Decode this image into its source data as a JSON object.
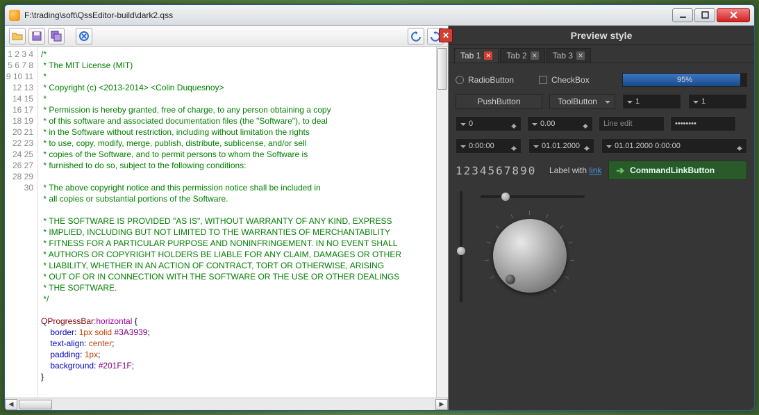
{
  "window": {
    "title": "F:\\trading\\soft\\QssEditor-build\\dark2.qss"
  },
  "editor": {
    "lines": [
      {
        "n": 1,
        "t": "/*",
        "cls": "c"
      },
      {
        "n": 2,
        "t": " * The MIT License (MIT)",
        "cls": "c"
      },
      {
        "n": 3,
        "t": " *",
        "cls": "c"
      },
      {
        "n": 4,
        "t": " * Copyright (c) <2013-2014> <Colin Duquesnoy>",
        "cls": "c"
      },
      {
        "n": 5,
        "t": " *",
        "cls": "c"
      },
      {
        "n": 6,
        "t": " * Permission is hereby granted, free of charge, to any person obtaining a copy",
        "cls": "c"
      },
      {
        "n": 7,
        "t": " * of this software and associated documentation files (the \"Software\"), to deal",
        "cls": "c"
      },
      {
        "n": 8,
        "t": " * in the Software without restriction, including without limitation the rights",
        "cls": "c"
      },
      {
        "n": 9,
        "t": " * to use, copy, modify, merge, publish, distribute, sublicense, and/or sell",
        "cls": "c"
      },
      {
        "n": 10,
        "t": " * copies of the Software, and to permit persons to whom the Software is",
        "cls": "c"
      },
      {
        "n": 11,
        "t": " * furnished to do so, subject to the following conditions:",
        "cls": "c"
      },
      {
        "n": 12,
        "t": "",
        "cls": "c"
      },
      {
        "n": 13,
        "t": " * The above copyright notice and this permission notice shall be included in",
        "cls": "c"
      },
      {
        "n": 14,
        "t": " * all copies or substantial portions of the Software.",
        "cls": "c"
      },
      {
        "n": 15,
        "t": "",
        "cls": "c"
      },
      {
        "n": 16,
        "t": " * THE SOFTWARE IS PROVIDED \"AS IS\", WITHOUT WARRANTY OF ANY KIND, EXPRESS",
        "cls": "c"
      },
      {
        "n": 17,
        "t": " * IMPLIED, INCLUDING BUT NOT LIMITED TO THE WARRANTIES OF MERCHANTABILITY",
        "cls": "c"
      },
      {
        "n": 18,
        "t": " * FITNESS FOR A PARTICULAR PURPOSE AND NONINFRINGEMENT. IN NO EVENT SHALL",
        "cls": "c"
      },
      {
        "n": 19,
        "t": " * AUTHORS OR COPYRIGHT HOLDERS BE LIABLE FOR ANY CLAIM, DAMAGES OR OTHER",
        "cls": "c"
      },
      {
        "n": 20,
        "t": " * LIABILITY, WHETHER IN AN ACTION OF CONTRACT, TORT OR OTHERWISE, ARISING",
        "cls": "c"
      },
      {
        "n": 21,
        "t": " * OUT OF OR IN CONNECTION WITH THE SOFTWARE OR THE USE OR OTHER DEALINGS",
        "cls": "c"
      },
      {
        "n": 22,
        "t": " * THE SOFTWARE.",
        "cls": "c"
      },
      {
        "n": 23,
        "t": " */",
        "cls": "c"
      },
      {
        "n": 24,
        "t": "",
        "cls": ""
      }
    ],
    "css_lines": [
      {
        "n": 25,
        "sel": "QProgressBar",
        "pseudo": ":horizontal",
        "tail": " {"
      },
      {
        "n": 26,
        "prop": "border",
        "val_raw": "1px solid ",
        "val_color": "#3A3939",
        "tail": ";"
      },
      {
        "n": 27,
        "prop": "text-align",
        "val_raw": "center",
        "tail": ";"
      },
      {
        "n": 28,
        "prop": "padding",
        "val_raw": "1px",
        "tail": ";"
      },
      {
        "n": 29,
        "prop": "background",
        "val_color": "#201F1F",
        "tail": ";"
      },
      {
        "n": 30,
        "plain": "}"
      }
    ],
    "current_line": 24
  },
  "preview": {
    "title": "Preview style",
    "tabs": [
      "Tab 1",
      "Tab 2",
      "Tab 3"
    ],
    "radio": "RadioButton",
    "check": "CheckBox",
    "progress": "95%",
    "push": "PushButton",
    "tool": "ToolButton",
    "combo1": "1",
    "combo2": "1",
    "spin_i": "0",
    "spin_d": "0.00",
    "line_ph": "Line edit",
    "pass": "••••••••",
    "time": "0:00:00",
    "date": "01.01.2000",
    "dt": "01.01.2000 0:00:00",
    "lcd": "1234567890",
    "label_pre": "Label with ",
    "label_link": "link",
    "cmd": "CommandLinkButton"
  }
}
